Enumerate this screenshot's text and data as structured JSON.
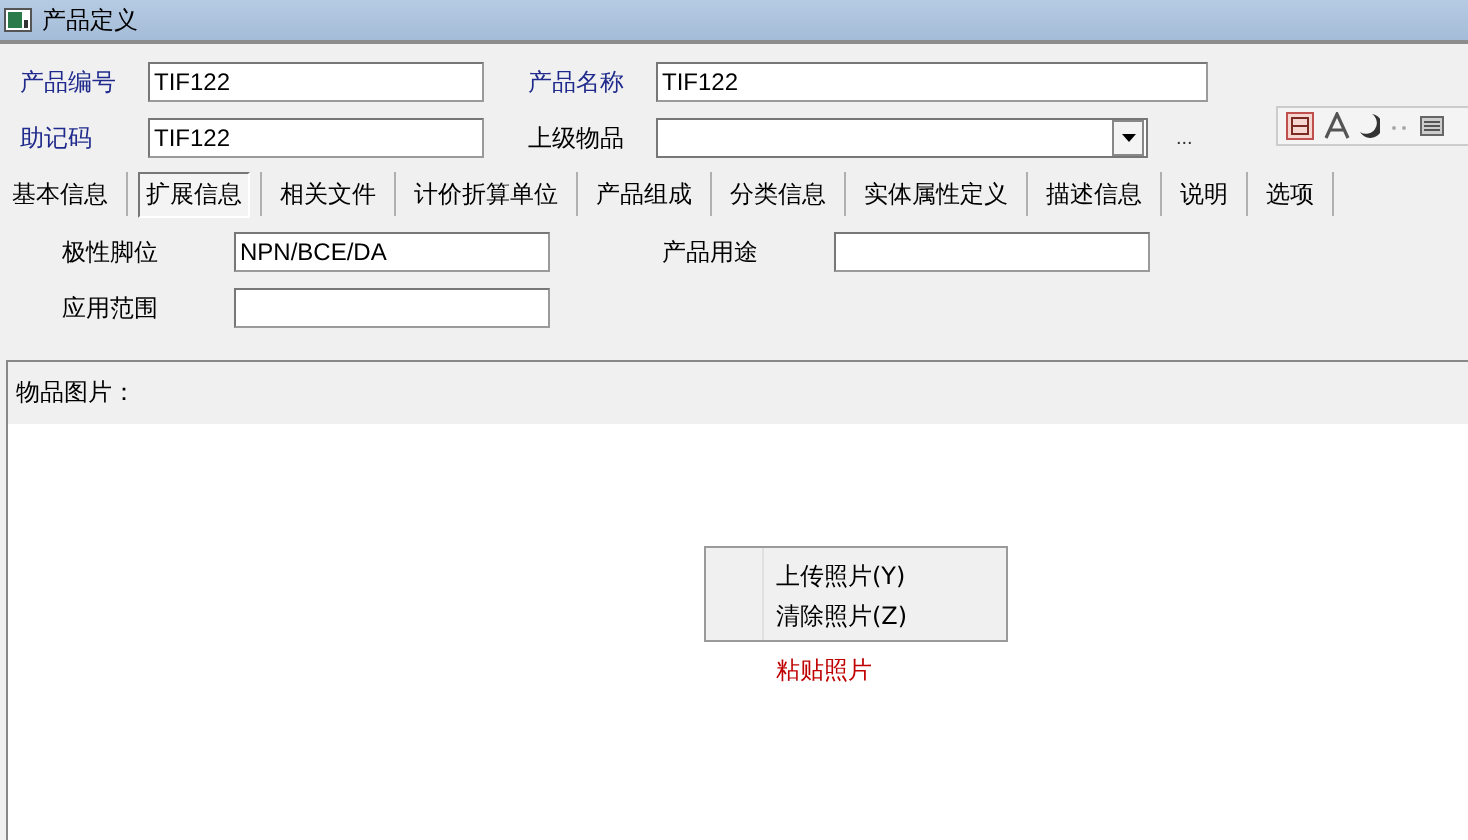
{
  "window": {
    "title": "产品定义"
  },
  "header_fields": [
    {
      "label": "产品编号",
      "value": "TIF122"
    },
    {
      "label": "产品名称",
      "value": "TIF122"
    },
    {
      "label": "助记码",
      "value": "TIF122"
    },
    {
      "label": "上级物品",
      "kind": "combo",
      "extra": "..."
    }
  ],
  "tabs": [
    {
      "label": "基本信息",
      "selected": false
    },
    {
      "label": "扩展信息",
      "selected": true
    },
    {
      "label": "相关文件",
      "selected": false
    },
    {
      "label": "计价折算单位",
      "selected": false
    },
    {
      "label": "产品组成",
      "selected": false
    },
    {
      "label": "分类信息",
      "selected": false
    },
    {
      "label": "实体属性定义",
      "selected": false
    },
    {
      "label": "描述信息",
      "selected": false
    },
    {
      "label": "说明",
      "selected": false
    },
    {
      "label": "选项",
      "selected": false
    }
  ],
  "ext_fields": [
    {
      "label": "极性脚位",
      "value": "NPN/BCE/DA"
    },
    {
      "label": "产品用途"
    },
    {
      "label": "应用范围"
    }
  ],
  "picture_panel": {
    "title": "物品图片：",
    "context_menu": [
      "上传照片(Y)",
      "清除照片(Z)"
    ],
    "paste_label": "粘贴照片"
  }
}
